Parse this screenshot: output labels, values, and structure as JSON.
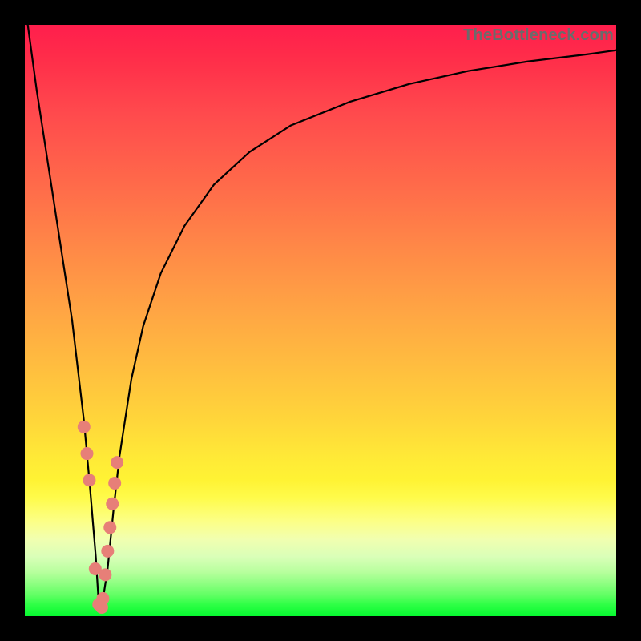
{
  "attribution": "TheBottleneck.com",
  "colors": {
    "frame": "#000000",
    "curve": "#000000",
    "markers": "#e77f78",
    "gradient_top": "#ff1e4c",
    "gradient_bottom": "#06f930"
  },
  "chart_data": {
    "type": "line",
    "title": "",
    "xlabel": "",
    "ylabel": "",
    "xlim": [
      0,
      100
    ],
    "ylim": [
      0,
      100
    ],
    "grid": false,
    "note": "Axis ticks and numeric labels are not rendered in the image; values estimated on a 0–100 normalized scale matching the plot area.",
    "series": [
      {
        "name": "bottleneck-curve",
        "type": "line",
        "x": [
          0.5,
          2,
          4,
          6,
          8,
          10,
          11,
          12,
          12.5,
          13,
          14,
          15,
          16,
          18,
          20,
          23,
          27,
          32,
          38,
          45,
          55,
          65,
          75,
          85,
          95,
          100
        ],
        "y": [
          100,
          89,
          76,
          63,
          50,
          33,
          22,
          10,
          2,
          1.5,
          8,
          18,
          27,
          40,
          49,
          58,
          66,
          73,
          78.5,
          83,
          87,
          90,
          92.2,
          93.8,
          95,
          95.7
        ]
      },
      {
        "name": "highlight-markers",
        "type": "scatter",
        "x": [
          10.0,
          10.5,
          10.9,
          11.9,
          12.5,
          13.0,
          13.2,
          13.6,
          14.0,
          14.4,
          14.8,
          15.2,
          15.6
        ],
        "y": [
          32,
          27.5,
          23,
          8,
          2.0,
          1.5,
          3.0,
          7.0,
          11.0,
          15.0,
          19.0,
          22.5,
          26.0
        ]
      }
    ]
  }
}
